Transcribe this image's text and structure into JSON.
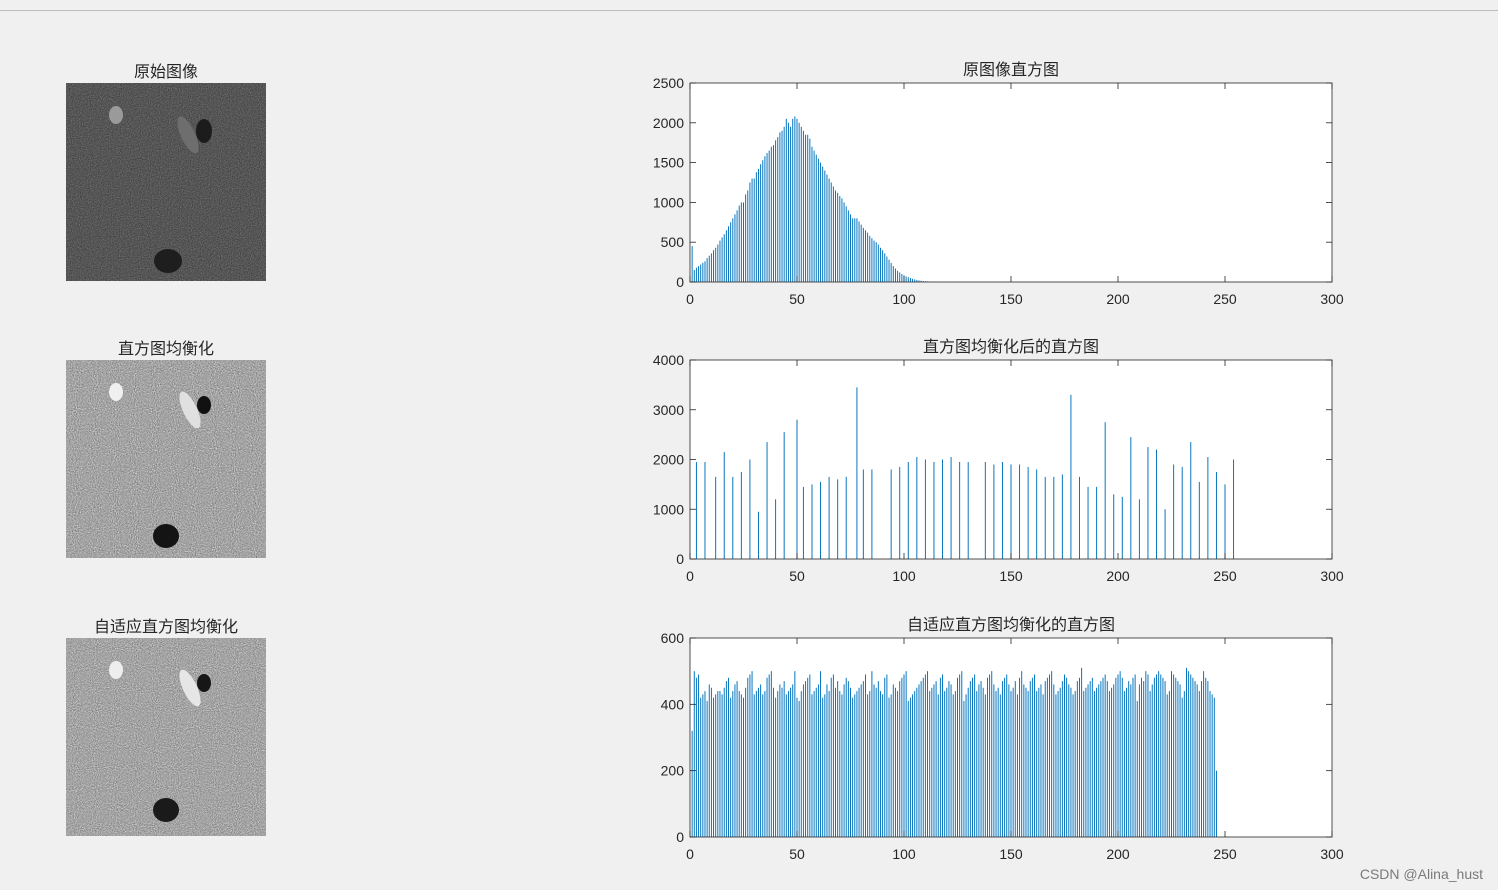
{
  "images": [
    {
      "title": "原始图像",
      "variant": "original"
    },
    {
      "title": "直方图均衡化",
      "variant": "equalized"
    },
    {
      "title": "自适应直方图均衡化",
      "variant": "adaptive"
    }
  ],
  "watermark": "CSDN @Alina_hust",
  "colors": {
    "bar": "#0072bd",
    "axes": "#262626",
    "background": "#f0f0f0"
  },
  "chart_data": [
    {
      "type": "bar",
      "title": "原图像直方图",
      "xlim": [
        0,
        300
      ],
      "ylim": [
        0,
        2500
      ],
      "xticks": [
        0,
        50,
        100,
        150,
        200,
        250,
        300
      ],
      "yticks": [
        0,
        500,
        1000,
        1500,
        2000,
        2500
      ],
      "x": [
        1,
        2,
        3,
        4,
        5,
        6,
        7,
        8,
        9,
        10,
        11,
        12,
        13,
        14,
        15,
        16,
        17,
        18,
        19,
        20,
        21,
        22,
        23,
        24,
        25,
        26,
        27,
        28,
        29,
        30,
        31,
        32,
        33,
        34,
        35,
        36,
        37,
        38,
        39,
        40,
        41,
        42,
        43,
        44,
        45,
        46,
        47,
        48,
        49,
        50,
        51,
        52,
        53,
        54,
        55,
        56,
        57,
        58,
        59,
        60,
        61,
        62,
        63,
        64,
        65,
        66,
        67,
        68,
        69,
        70,
        71,
        72,
        73,
        74,
        75,
        76,
        77,
        78,
        79,
        80,
        81,
        82,
        83,
        84,
        85,
        86,
        87,
        88,
        89,
        90,
        91,
        92,
        93,
        94,
        95,
        96,
        97,
        98,
        99,
        100,
        101,
        102,
        103,
        104,
        105,
        106,
        107,
        108,
        109,
        110,
        111,
        112,
        113,
        114,
        115,
        116,
        117,
        118,
        119,
        120,
        121,
        122,
        123,
        124,
        125,
        126,
        127,
        128,
        129,
        130,
        131,
        132,
        133,
        134,
        135
      ],
      "values": [
        450,
        150,
        180,
        200,
        220,
        240,
        260,
        300,
        330,
        360,
        400,
        430,
        470,
        520,
        560,
        600,
        650,
        700,
        750,
        800,
        850,
        900,
        960,
        1000,
        1000,
        1100,
        1150,
        1250,
        1300,
        1300,
        1380,
        1420,
        1480,
        1530,
        1580,
        1620,
        1650,
        1700,
        1720,
        1780,
        1820,
        1880,
        1900,
        1950,
        2050,
        2000,
        1950,
        2050,
        2080,
        2050,
        2000,
        1950,
        1900,
        1850,
        1850,
        1800,
        1700,
        1650,
        1600,
        1550,
        1500,
        1450,
        1400,
        1350,
        1300,
        1250,
        1200,
        1150,
        1120,
        1080,
        1050,
        1000,
        950,
        900,
        850,
        800,
        800,
        800,
        760,
        720,
        680,
        650,
        620,
        580,
        550,
        520,
        500,
        470,
        430,
        400,
        360,
        320,
        280,
        240,
        200,
        170,
        140,
        120,
        100,
        85,
        70,
        60,
        50,
        40,
        32,
        26,
        20,
        16,
        12,
        9,
        7,
        5,
        4,
        3,
        2,
        2,
        1,
        1,
        1,
        0,
        0,
        0,
        0,
        0,
        0,
        0,
        0,
        0,
        0,
        0,
        0,
        0,
        0,
        0,
        0,
        0,
        0,
        0
      ]
    },
    {
      "type": "bar",
      "title": "直方图均衡化后的直方图",
      "xlim": [
        0,
        300
      ],
      "ylim": [
        0,
        4000
      ],
      "xticks": [
        0,
        50,
        100,
        150,
        200,
        250,
        300
      ],
      "yticks": [
        0,
        1000,
        2000,
        3000,
        4000
      ],
      "x": [
        3,
        7,
        12,
        16,
        20,
        24,
        28,
        32,
        36,
        40,
        44,
        50,
        53,
        57,
        61,
        65,
        69,
        73,
        78,
        81,
        85,
        94,
        98,
        102,
        106,
        110,
        114,
        118,
        122,
        126,
        130,
        138,
        142,
        146,
        150,
        154,
        158,
        162,
        166,
        170,
        174,
        178,
        182,
        186,
        190,
        194,
        198,
        202,
        206,
        210,
        214,
        218,
        222,
        226,
        230,
        234,
        238,
        242,
        246,
        250,
        254
      ],
      "values": [
        1950,
        1950,
        1650,
        2150,
        1650,
        1750,
        2000,
        950,
        2350,
        1200,
        2550,
        2800,
        1450,
        1500,
        1550,
        1650,
        1600,
        1650,
        3450,
        1800,
        1800,
        1800,
        1850,
        1950,
        2050,
        2000,
        1950,
        2000,
        2050,
        1950,
        1950,
        1950,
        1900,
        1950,
        1900,
        1900,
        1850,
        1800,
        1650,
        1650,
        1700,
        3300,
        1650,
        1450,
        1450,
        2750,
        1300,
        1250,
        2450,
        1200,
        2250,
        2200,
        1000,
        1900,
        1850,
        2350,
        1550,
        2050,
        1750,
        1500,
        2000,
        1550,
        1900
      ]
    },
    {
      "type": "bar",
      "title": "自适应直方图均衡化的直方图",
      "xlim": [
        0,
        300
      ],
      "ylim": [
        0,
        600
      ],
      "xticks": [
        0,
        50,
        100,
        150,
        200,
        250,
        300
      ],
      "yticks": [
        0,
        200,
        400,
        600
      ],
      "x": [
        1,
        2,
        3,
        4,
        5,
        6,
        7,
        8,
        9,
        10,
        11,
        12,
        13,
        14,
        15,
        16,
        17,
        18,
        19,
        20,
        21,
        22,
        23,
        24,
        25,
        26,
        27,
        28,
        29,
        30,
        31,
        32,
        33,
        34,
        35,
        36,
        37,
        38,
        39,
        40,
        41,
        42,
        43,
        44,
        45,
        46,
        47,
        48,
        49,
        50,
        51,
        52,
        53,
        54,
        55,
        56,
        57,
        58,
        59,
        60,
        61,
        62,
        63,
        64,
        65,
        66,
        67,
        68,
        69,
        70,
        71,
        72,
        73,
        74,
        75,
        76,
        77,
        78,
        79,
        80,
        81,
        82,
        83,
        84,
        85,
        86,
        87,
        88,
        89,
        90,
        91,
        92,
        93,
        94,
        95,
        96,
        97,
        98,
        99,
        100,
        101,
        102,
        103,
        104,
        105,
        106,
        107,
        108,
        109,
        110,
        111,
        112,
        113,
        114,
        115,
        116,
        117,
        118,
        119,
        120,
        121,
        122,
        123,
        124,
        125,
        126,
        127,
        128,
        129,
        130,
        131,
        132,
        133,
        134,
        135,
        136,
        137,
        138,
        139,
        140,
        141,
        142,
        143,
        144,
        145,
        146,
        147,
        148,
        149,
        150,
        151,
        152,
        153,
        154,
        155,
        156,
        157,
        158,
        159,
        160,
        161,
        162,
        163,
        164,
        165,
        166,
        167,
        168,
        169,
        170,
        171,
        172,
        173,
        174,
        175,
        176,
        177,
        178,
        179,
        180,
        181,
        182,
        183,
        184,
        185,
        186,
        187,
        188,
        189,
        190,
        191,
        192,
        193,
        194,
        195,
        196,
        197,
        198,
        199,
        200,
        201,
        202,
        203,
        204,
        205,
        206,
        207,
        208,
        209,
        210,
        211,
        212,
        213,
        214,
        215,
        216,
        217,
        218,
        219,
        220,
        221,
        222,
        223,
        224,
        225,
        226,
        227,
        228,
        229,
        230,
        231,
        232,
        233,
        234,
        235,
        236,
        237,
        238,
        239,
        240,
        241,
        242,
        243,
        244,
        245,
        246,
        247,
        248,
        249,
        250,
        251,
        252,
        253,
        254,
        255,
        256
      ],
      "values": [
        320,
        500,
        480,
        490,
        420,
        430,
        440,
        410,
        460,
        450,
        420,
        430,
        440,
        440,
        430,
        450,
        470,
        480,
        420,
        440,
        460,
        470,
        440,
        430,
        420,
        450,
        480,
        490,
        500,
        430,
        440,
        450,
        460,
        430,
        440,
        480,
        490,
        500,
        450,
        420,
        440,
        460,
        450,
        470,
        430,
        440,
        450,
        460,
        500,
        420,
        410,
        440,
        460,
        470,
        480,
        490,
        430,
        440,
        450,
        460,
        500,
        420,
        430,
        460,
        440,
        480,
        490,
        450,
        470,
        440,
        430,
        460,
        480,
        470,
        450,
        420,
        430,
        440,
        450,
        460,
        470,
        490,
        430,
        440,
        500,
        460,
        450,
        470,
        440,
        430,
        480,
        490,
        420,
        430,
        460,
        450,
        440,
        470,
        480,
        490,
        500,
        410,
        420,
        430,
        440,
        450,
        460,
        470,
        480,
        490,
        500,
        440,
        450,
        460,
        470,
        430,
        480,
        490,
        440,
        450,
        470,
        460,
        430,
        440,
        480,
        490,
        500,
        410,
        430,
        450,
        470,
        480,
        490,
        440,
        460,
        470,
        450,
        430,
        480,
        490,
        500,
        460,
        440,
        450,
        430,
        470,
        480,
        490,
        460,
        440,
        450,
        470,
        430,
        480,
        500,
        460,
        450,
        440,
        470,
        480,
        490,
        440,
        450,
        460,
        430,
        470,
        480,
        490,
        500,
        460,
        430,
        440,
        450,
        470,
        490,
        480,
        460,
        450,
        430,
        440,
        470,
        480,
        510,
        440,
        450,
        460,
        470,
        480,
        440,
        450,
        460,
        470,
        480,
        490,
        470,
        440,
        450,
        460,
        480,
        490,
        500,
        480,
        440,
        450,
        470,
        460,
        480,
        490,
        410,
        460,
        480,
        470,
        500,
        490,
        440,
        460,
        480,
        490,
        500,
        490,
        480,
        470,
        430,
        440,
        500,
        490,
        480,
        470,
        460,
        420,
        440,
        510,
        500,
        490,
        480,
        470,
        460,
        440,
        470,
        500,
        480,
        470,
        440,
        430,
        420,
        200
      ]
    }
  ]
}
